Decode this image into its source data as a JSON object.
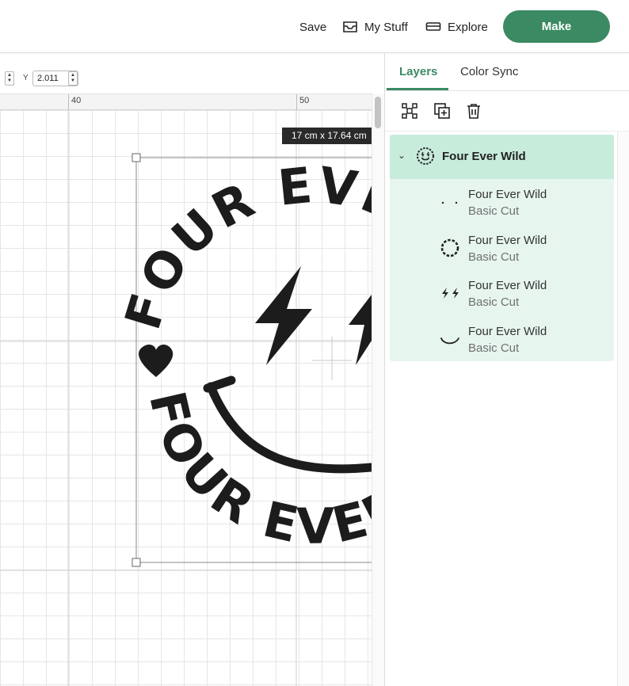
{
  "topbar": {
    "save_label": "Save",
    "mystuff_label": "My Stuff",
    "explore_label": "Explore",
    "make_label": "Make",
    "accent_color": "#3b8a63"
  },
  "coords": {
    "y_label": "Y",
    "y_value": "2.011"
  },
  "ruler": {
    "labels": [
      "40",
      "50"
    ]
  },
  "canvas": {
    "size_badge": "17  cm x 17.64  cm",
    "design_text_top": "FOUR EVER",
    "design_text_bottom": "FOUR EVER"
  },
  "panel": {
    "tabs": [
      {
        "label": "Layers",
        "active": true
      },
      {
        "label": "Color Sync",
        "active": false
      }
    ],
    "tools": [
      "ungroup-icon",
      "duplicate-icon",
      "delete-icon"
    ],
    "group": {
      "name": "Four Ever Wild",
      "icon": "smiley-icon",
      "layers": [
        {
          "name": "Four Ever Wild",
          "type": "Basic Cut",
          "icon": "eyes-dots-icon"
        },
        {
          "name": "Four Ever Wild",
          "type": "Basic Cut",
          "icon": "ring-icon"
        },
        {
          "name": "Four Ever Wild",
          "type": "Basic Cut",
          "icon": "bolts-icon"
        },
        {
          "name": "Four Ever Wild",
          "type": "Basic Cut",
          "icon": "smile-icon"
        }
      ]
    }
  }
}
